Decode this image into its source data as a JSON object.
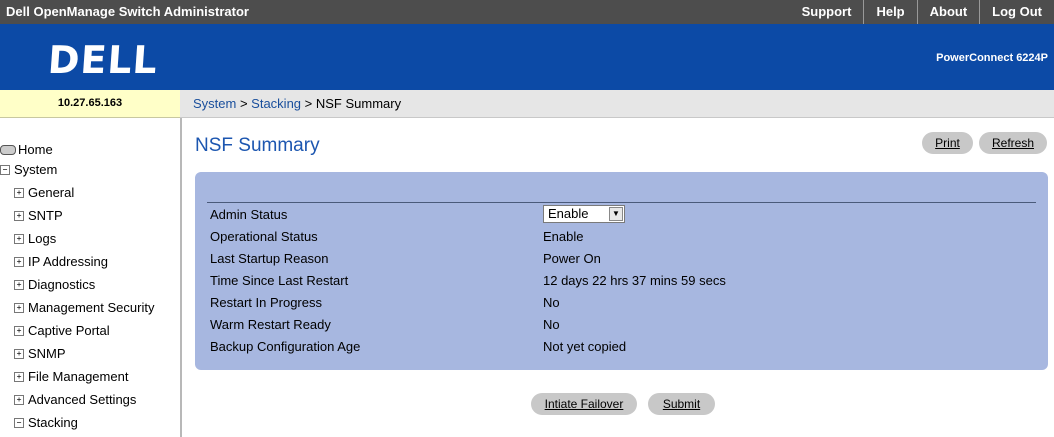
{
  "topbar": {
    "app_title": "Dell OpenManage Switch Administrator",
    "nav": [
      "Support",
      "Help",
      "About",
      "Log Out"
    ]
  },
  "banner": {
    "logo": "DELL",
    "model": "PowerConnect 6224P"
  },
  "ip_address": "10.27.65.163",
  "breadcrumb": {
    "part1": "System",
    "sep1": " > ",
    "part2": "Stacking",
    "sep2": " > ",
    "part3": "NSF Summary"
  },
  "sidebar": {
    "items": [
      {
        "label": "Home"
      },
      {
        "label": "System"
      },
      {
        "label": "General"
      },
      {
        "label": "SNTP"
      },
      {
        "label": "Logs"
      },
      {
        "label": "IP Addressing"
      },
      {
        "label": "Diagnostics"
      },
      {
        "label": "Management Security"
      },
      {
        "label": "Captive Portal"
      },
      {
        "label": "SNMP"
      },
      {
        "label": "File Management"
      },
      {
        "label": "Advanced Settings"
      },
      {
        "label": "Stacking"
      }
    ]
  },
  "page_title": "NSF Summary",
  "buttons": {
    "print": "Print",
    "refresh": "Refresh",
    "initiate_failover": "Intiate Failover",
    "submit": "Submit"
  },
  "table": {
    "rows": [
      {
        "label": "Admin Status",
        "value": "Enable",
        "type": "select"
      },
      {
        "label": "Operational Status",
        "value": "Enable"
      },
      {
        "label": "Last Startup Reason",
        "value": "Power On"
      },
      {
        "label": "Time Since Last Restart",
        "value": "12 days 22 hrs 37 mins 59 secs"
      },
      {
        "label": "Restart In Progress",
        "value": "No"
      },
      {
        "label": "Warm Restart Ready",
        "value": "No"
      },
      {
        "label": "Backup Configuration Age",
        "value": "Not yet copied"
      }
    ]
  },
  "colors": {
    "banner": "#0c4aa6",
    "panel": "#a7b7e0",
    "title": "#1c56b0",
    "topbar": "#4d4d4d"
  }
}
